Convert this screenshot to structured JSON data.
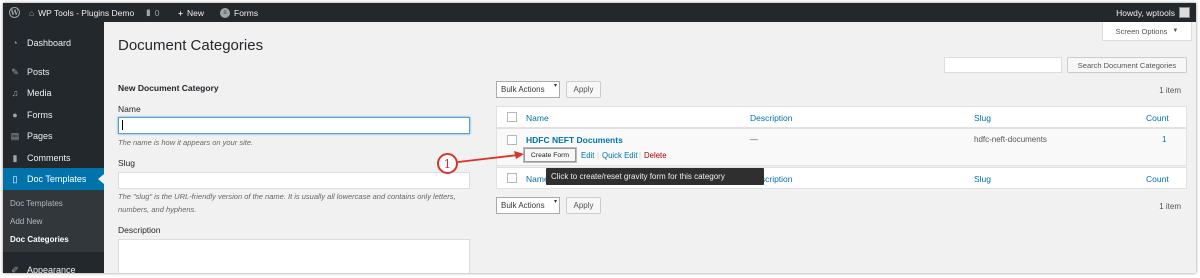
{
  "adminbar": {
    "site_name": "WP Tools - Plugins Demo",
    "comments_count": "0",
    "new_label": "New",
    "forms_label": "Forms",
    "greeting": "Howdy, wptools"
  },
  "sidebar": {
    "items": [
      {
        "label": "Dashboard",
        "icon": "dashboard-icon"
      },
      {
        "label": "Posts",
        "icon": "pin-icon"
      },
      {
        "label": "Media",
        "icon": "media-icon"
      },
      {
        "label": "Forms",
        "icon": "forms-icon"
      },
      {
        "label": "Pages",
        "icon": "pages-icon"
      },
      {
        "label": "Comments",
        "icon": "comment-icon"
      },
      {
        "label": "Doc Templates",
        "icon": "document-icon"
      },
      {
        "label": "Appearance",
        "icon": "brush-icon"
      }
    ],
    "submenu": [
      "Doc Templates",
      "Add New",
      "Doc Categories"
    ]
  },
  "page": {
    "title": "Document Categories",
    "screen_options": "Screen Options"
  },
  "form": {
    "heading": "New Document Category",
    "name_label": "Name",
    "name_help": "The name is how it appears on your site.",
    "slug_label": "Slug",
    "slug_help": "The \"slug\" is the URL-friendly version of the name. It is usually all lowercase and contains only letters, numbers, and hyphens.",
    "description_label": "Description"
  },
  "toolbar": {
    "bulk_actions": "Bulk Actions",
    "apply": "Apply",
    "search_button": "Search Document Categories",
    "items_count": "1 item"
  },
  "table": {
    "columns": [
      "Name",
      "Description",
      "Slug",
      "Count"
    ],
    "rows": [
      {
        "name": "HDFC NEFT Documents",
        "description": "—",
        "slug": "hdfc-neft-documents",
        "count": "1",
        "actions": {
          "create_form": "Create Form",
          "edit": "Edit",
          "quick_edit": "Quick Edit",
          "delete": "Delete"
        }
      }
    ]
  },
  "tooltip": "Click to create/reset gravity form for this category",
  "callout_number": "1",
  "colors": {
    "accent": "#0073aa",
    "adminbar": "#23282d",
    "callout": "#d9342b",
    "delete": "#aa0000"
  }
}
